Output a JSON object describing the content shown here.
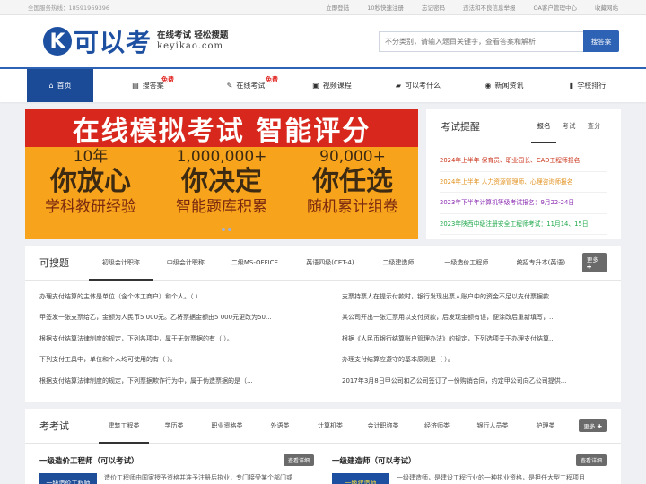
{
  "topbar": {
    "hotline": "全国服务热线：18591969396",
    "links": [
      "立即登陆",
      "10秒快速注册",
      "忘记密码",
      "违法和不良信息举报",
      "OA客户管理中心",
      "收藏网站"
    ]
  },
  "header": {
    "logo_letter": "K",
    "logo_name": "可以考",
    "slogan": "在线考试 轻松搜题",
    "domain": "keyikao.com",
    "search_placeholder": "不分类别，请输入题目关键字，查看答案和解析",
    "search_button": "搜答案"
  },
  "nav": {
    "items": [
      {
        "label": "首页",
        "icon": "home-icon",
        "glyph": "⌂"
      },
      {
        "label": "搜答案",
        "icon": "list-icon",
        "glyph": "▤",
        "badge": "免费"
      },
      {
        "label": "在线考试",
        "icon": "pencil-icon",
        "glyph": "✎",
        "badge": "免费"
      },
      {
        "label": "视频课程",
        "icon": "video-icon",
        "glyph": "▣"
      },
      {
        "label": "可以考什么",
        "icon": "folder-icon",
        "glyph": "▰"
      },
      {
        "label": "新闻资讯",
        "icon": "globe-icon",
        "glyph": "◉"
      },
      {
        "label": "学校排行",
        "icon": "ranking-icon",
        "glyph": "▮"
      }
    ]
  },
  "banner": {
    "headline": "在线模拟考试 智能评分",
    "columns": [
      {
        "num": "10年",
        "big": "你放心",
        "small": "学科教研经验"
      },
      {
        "num": "1,000,000+",
        "big": "你决定",
        "small": "智能题库积累"
      },
      {
        "num": "90,000+",
        "big": "你任选",
        "small": "随机累计组卷"
      }
    ]
  },
  "reminder": {
    "title": "考试提醒",
    "tabs": [
      "报名",
      "考试",
      "查分"
    ],
    "items": [
      {
        "text": "2024年上半年 保育员、职业园长、CAD工程师报名",
        "color": "#c9341b"
      },
      {
        "text": "2024年上半年 人力资源管理师、心理咨询师报名",
        "color": "#e0901c"
      },
      {
        "text": "2023年下半年计算机等级考试报名：9月22-24日",
        "color": "#8a2bb0"
      },
      {
        "text": "2023年陕西中级注册安全工程师考试：11月14、15日",
        "color": "#1fa84a"
      }
    ]
  },
  "search_card": {
    "title": "可搜题",
    "tabs": [
      "初级会计职称",
      "中级会计职称",
      "二级MS-OFFICE",
      "英语四级(CET-4)",
      "二级建造师",
      "一级造价工程师",
      "统招专升本(英语)"
    ],
    "more": "更多",
    "questions": [
      "办理支付结算的主体是单位（含个体工商户）和个人。（ ）",
      "支票持票人在提示付款时，银行发现出票人账户中的资金不足以支付票据款...",
      "甲签发一张支票给乙，金额为人民币5 000元。乙将票据金额由5 000元更改为50...",
      "某公司开出一张汇票用以支付货款，后发现金额有误，便涂改后重新填写，...",
      "根据支付结算法律制度的规定，下列各项中，属于无效票据的有（ ）。",
      "根据《人民币银行结算账户管理办法》的规定，下列选项关于办理支付结算...",
      "下列支付工具中，单位和个人均可使用的有（ ）。",
      "办理支付结算应遵守的基本原则是（ ）。",
      "根据支付结算法律制度的规定，下列票据欺诈行为中，属于伪造票据的是（...",
      "2017年3月8日甲公司和乙公司签订了一份购销合同，约定甲公司向乙公司提供..."
    ]
  },
  "exam_card": {
    "title": "考考试",
    "tabs": [
      "建筑工程类",
      "学历类",
      "职业资格类",
      "外语类",
      "计算机类",
      "会计职称类",
      "经济师类",
      "银行人员类",
      "护理类"
    ],
    "more": "更多",
    "columns": [
      {
        "title": "一级造价工程师（可以考试）",
        "detail": "查看详细",
        "thumb": "一级造价工程师",
        "desc": "造价工程师由国家授予资格并准予注册后执业，专门接受某个部门或"
      },
      {
        "title": "一级建造师（可以考试）",
        "detail": "查看详细",
        "thumb": "一级建造师",
        "desc": "一级建造师，是建设工程行业的一种执业资格，是担任大型工程项目"
      }
    ]
  }
}
